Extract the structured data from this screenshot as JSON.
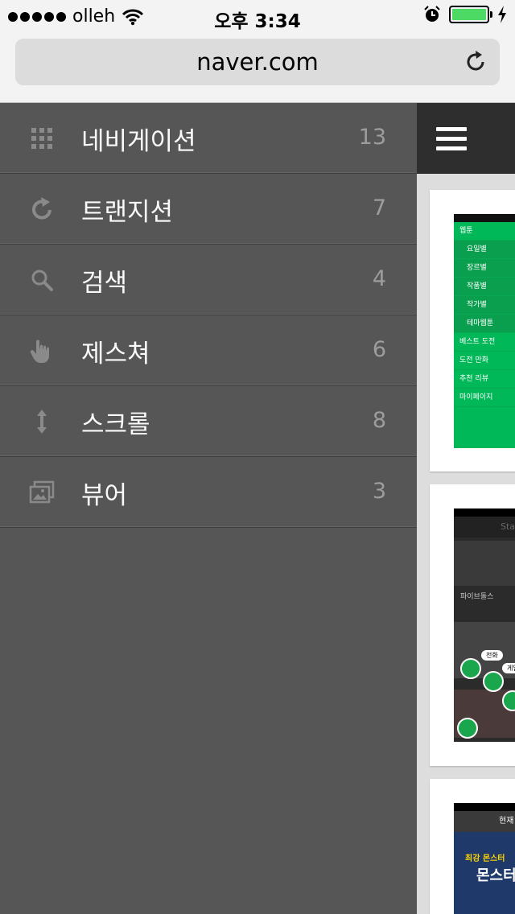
{
  "status_bar": {
    "carrier": "olleh",
    "time": "오후 3:34"
  },
  "browser": {
    "url": "naver.com"
  },
  "menu": {
    "items": [
      {
        "icon": "grid-icon",
        "label": "네비게이션",
        "count": "13"
      },
      {
        "icon": "refresh-icon",
        "label": "트랜지션",
        "count": "7"
      },
      {
        "icon": "search-icon",
        "label": "검색",
        "count": "4"
      },
      {
        "icon": "hand-pointer-icon",
        "label": "제스쳐",
        "count": "6"
      },
      {
        "icon": "vertical-arrows-icon",
        "label": "스크롤",
        "count": "8"
      },
      {
        "icon": "gallery-icon",
        "label": "뷰어",
        "count": "3"
      }
    ]
  },
  "preview": {
    "webtoon_menu": [
      "웹툰",
      "요일별",
      "장르별",
      "작품별",
      "작가별",
      "테마웹툰",
      "베스트 도전",
      "도전 만화",
      "추천 리뷰",
      "마이페이지"
    ],
    "card2_title": "Sta",
    "card2_caption": "파이브돌스",
    "card2_bubbles": [
      "전화",
      "게임"
    ],
    "card3_title": "현재",
    "card3_banner_top": "최강 몬스터",
    "card3_banner_main": "몬스터"
  },
  "colors": {
    "menu_bg": "#565656",
    "accent_green": "#00b858",
    "battery_green": "#4cd964"
  }
}
